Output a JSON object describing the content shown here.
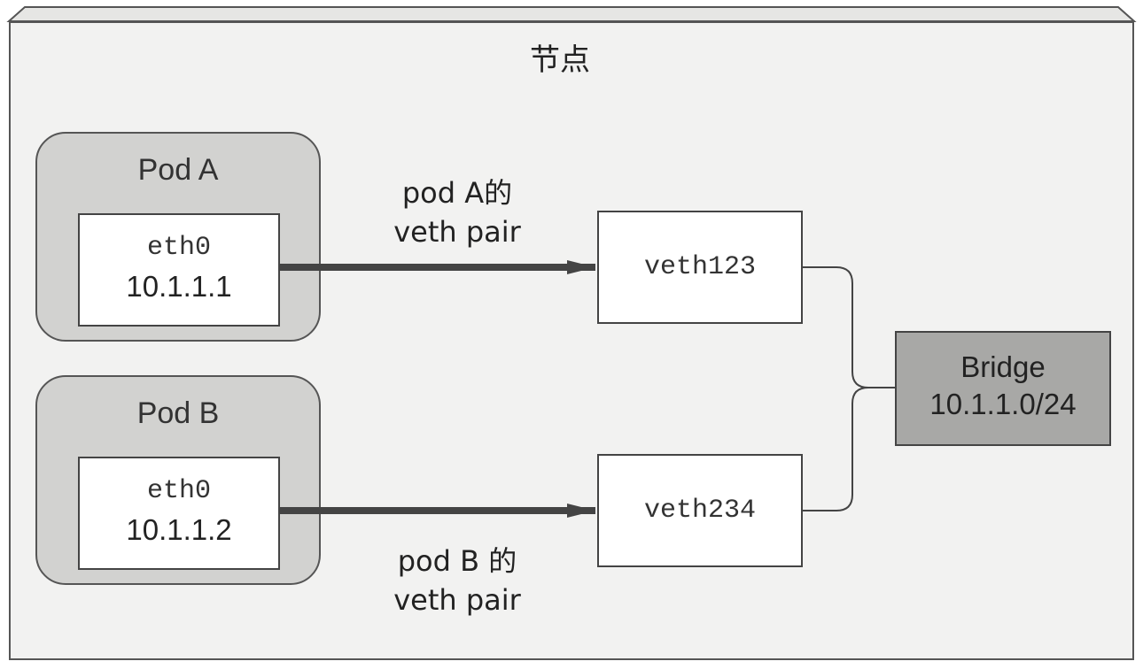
{
  "node": {
    "title": "节点"
  },
  "pods": [
    {
      "label": "Pod A",
      "iface": "eth0",
      "ip": "10.1.1.1"
    },
    {
      "label": "Pod B",
      "iface": "eth0",
      "ip": "10.1.1.2"
    }
  ],
  "veths": [
    {
      "name": "veth123",
      "pair_label_line1": "pod A的",
      "pair_label_line2": "veth pair"
    },
    {
      "name": "veth234",
      "pair_label_line1": "pod B 的",
      "pair_label_line2": "veth pair"
    }
  ],
  "bridge": {
    "label": "Bridge",
    "subnet": "10.1.1.0/24"
  },
  "colors": {
    "pod_fill": "#d2d2d0",
    "bridge_fill": "#a8a8a6",
    "frame_fill": "#f2f2f1",
    "line": "#444444"
  }
}
